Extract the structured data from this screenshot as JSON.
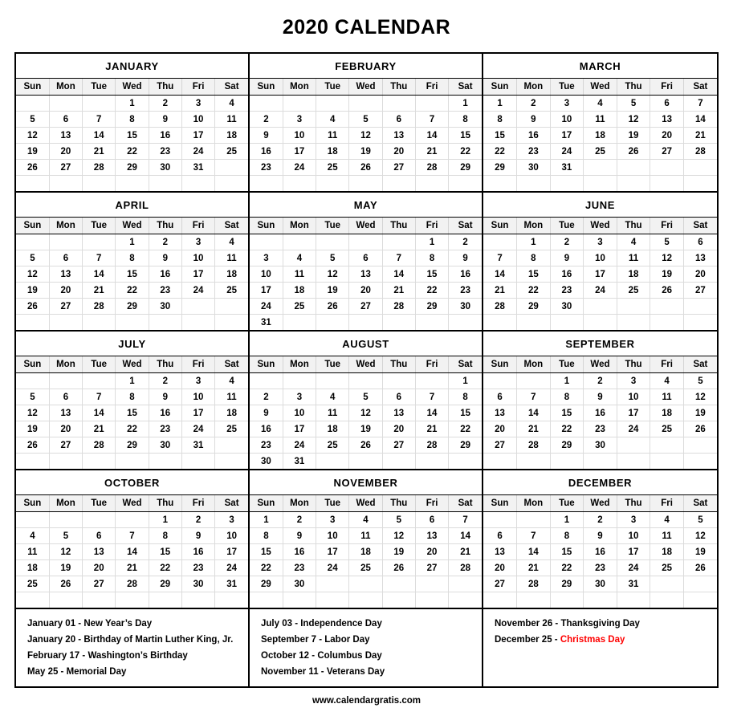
{
  "page": {
    "title": "2020 CALENDAR",
    "footer_url": "www.calendargratis.com",
    "year": 2020,
    "accent_red": "#ff0000",
    "header_bg": "#f2f2f2",
    "highlight_bg": "#ededed"
  },
  "weekdays": [
    "Sun",
    "Mon",
    "Tue",
    "Wed",
    "Thu",
    "Fri",
    "Sat"
  ],
  "months": [
    {
      "name": "JANUARY",
      "weeks": [
        [
          "",
          "",
          "",
          "1",
          "2",
          "3",
          "4"
        ],
        [
          "5",
          "6",
          "7",
          "8",
          "9",
          "10",
          "11"
        ],
        [
          "12",
          "13",
          "14",
          "15",
          "16",
          "17",
          "18"
        ],
        [
          "19",
          "20",
          "21",
          "22",
          "23",
          "24",
          "25"
        ],
        [
          "26",
          "27",
          "28",
          "29",
          "30",
          "31",
          ""
        ],
        [
          "",
          "",
          "",
          "",
          "",
          "",
          ""
        ]
      ],
      "highlight": []
    },
    {
      "name": "FEBRUARY",
      "weeks": [
        [
          "",
          "",
          "",
          "",
          "",
          "",
          "1"
        ],
        [
          "2",
          "3",
          "4",
          "5",
          "6",
          "7",
          "8"
        ],
        [
          "9",
          "10",
          "11",
          "12",
          "13",
          "14",
          "15"
        ],
        [
          "16",
          "17",
          "18",
          "19",
          "20",
          "21",
          "22"
        ],
        [
          "23",
          "24",
          "25",
          "26",
          "27",
          "28",
          "29"
        ],
        [
          "",
          "",
          "",
          "",
          "",
          "",
          ""
        ]
      ],
      "highlight": [
        [
          4,
          6
        ]
      ]
    },
    {
      "name": "MARCH",
      "weeks": [
        [
          "1",
          "2",
          "3",
          "4",
          "5",
          "6",
          "7"
        ],
        [
          "8",
          "9",
          "10",
          "11",
          "12",
          "13",
          "14"
        ],
        [
          "15",
          "16",
          "17",
          "18",
          "19",
          "20",
          "21"
        ],
        [
          "22",
          "23",
          "24",
          "25",
          "26",
          "27",
          "28"
        ],
        [
          "29",
          "30",
          "31",
          "",
          "",
          "",
          ""
        ],
        [
          "",
          "",
          "",
          "",
          "",
          "",
          ""
        ]
      ],
      "highlight": []
    },
    {
      "name": "APRIL",
      "weeks": [
        [
          "",
          "",
          "",
          "1",
          "2",
          "3",
          "4"
        ],
        [
          "5",
          "6",
          "7",
          "8",
          "9",
          "10",
          "11"
        ],
        [
          "12",
          "13",
          "14",
          "15",
          "16",
          "17",
          "18"
        ],
        [
          "19",
          "20",
          "21",
          "22",
          "23",
          "24",
          "25"
        ],
        [
          "26",
          "27",
          "28",
          "29",
          "30",
          "",
          ""
        ],
        [
          "",
          "",
          "",
          "",
          "",
          "",
          ""
        ]
      ],
      "highlight": []
    },
    {
      "name": "MAY",
      "weeks": [
        [
          "",
          "",
          "",
          "",
          "",
          "1",
          "2"
        ],
        [
          "3",
          "4",
          "5",
          "6",
          "7",
          "8",
          "9"
        ],
        [
          "10",
          "11",
          "12",
          "13",
          "14",
          "15",
          "16"
        ],
        [
          "17",
          "18",
          "19",
          "20",
          "21",
          "22",
          "23"
        ],
        [
          "24",
          "25",
          "26",
          "27",
          "28",
          "29",
          "30"
        ],
        [
          "31",
          "",
          "",
          "",
          "",
          "",
          ""
        ]
      ],
      "highlight": []
    },
    {
      "name": "JUNE",
      "weeks": [
        [
          "",
          "1",
          "2",
          "3",
          "4",
          "5",
          "6"
        ],
        [
          "7",
          "8",
          "9",
          "10",
          "11",
          "12",
          "13"
        ],
        [
          "14",
          "15",
          "16",
          "17",
          "18",
          "19",
          "20"
        ],
        [
          "21",
          "22",
          "23",
          "24",
          "25",
          "26",
          "27"
        ],
        [
          "28",
          "29",
          "30",
          "",
          "",
          "",
          ""
        ],
        [
          "",
          "",
          "",
          "",
          "",
          "",
          ""
        ]
      ],
      "highlight": []
    },
    {
      "name": "JULY",
      "weeks": [
        [
          "",
          "",
          "",
          "1",
          "2",
          "3",
          "4"
        ],
        [
          "5",
          "6",
          "7",
          "8",
          "9",
          "10",
          "11"
        ],
        [
          "12",
          "13",
          "14",
          "15",
          "16",
          "17",
          "18"
        ],
        [
          "19",
          "20",
          "21",
          "22",
          "23",
          "24",
          "25"
        ],
        [
          "26",
          "27",
          "28",
          "29",
          "30",
          "31",
          ""
        ],
        [
          "",
          "",
          "",
          "",
          "",
          "",
          ""
        ]
      ],
      "highlight": []
    },
    {
      "name": "AUGUST",
      "weeks": [
        [
          "",
          "",
          "",
          "",
          "",
          "",
          "1"
        ],
        [
          "2",
          "3",
          "4",
          "5",
          "6",
          "7",
          "8"
        ],
        [
          "9",
          "10",
          "11",
          "12",
          "13",
          "14",
          "15"
        ],
        [
          "16",
          "17",
          "18",
          "19",
          "20",
          "21",
          "22"
        ],
        [
          "23",
          "24",
          "25",
          "26",
          "27",
          "28",
          "29"
        ],
        [
          "30",
          "31",
          "",
          "",
          "",
          "",
          ""
        ]
      ],
      "highlight": []
    },
    {
      "name": "SEPTEMBER",
      "weeks": [
        [
          "",
          "",
          "1",
          "2",
          "3",
          "4",
          "5"
        ],
        [
          "6",
          "7",
          "8",
          "9",
          "10",
          "11",
          "12"
        ],
        [
          "13",
          "14",
          "15",
          "16",
          "17",
          "18",
          "19"
        ],
        [
          "20",
          "21",
          "22",
          "23",
          "24",
          "25",
          "26"
        ],
        [
          "27",
          "28",
          "29",
          "30",
          "",
          "",
          ""
        ],
        [
          "",
          "",
          "",
          "",
          "",
          "",
          ""
        ]
      ],
      "highlight": []
    },
    {
      "name": "OCTOBER",
      "weeks": [
        [
          "",
          "",
          "",
          "",
          "1",
          "2",
          "3"
        ],
        [
          "4",
          "5",
          "6",
          "7",
          "8",
          "9",
          "10"
        ],
        [
          "11",
          "12",
          "13",
          "14",
          "15",
          "16",
          "17"
        ],
        [
          "18",
          "19",
          "20",
          "21",
          "22",
          "23",
          "24"
        ],
        [
          "25",
          "26",
          "27",
          "28",
          "29",
          "30",
          "31"
        ],
        [
          "",
          "",
          "",
          "",
          "",
          "",
          ""
        ]
      ],
      "highlight": []
    },
    {
      "name": "NOVEMBER",
      "weeks": [
        [
          "1",
          "2",
          "3",
          "4",
          "5",
          "6",
          "7"
        ],
        [
          "8",
          "9",
          "10",
          "11",
          "12",
          "13",
          "14"
        ],
        [
          "15",
          "16",
          "17",
          "18",
          "19",
          "20",
          "21"
        ],
        [
          "22",
          "23",
          "24",
          "25",
          "26",
          "27",
          "28"
        ],
        [
          "29",
          "30",
          "",
          "",
          "",
          "",
          ""
        ],
        [
          "",
          "",
          "",
          "",
          "",
          "",
          ""
        ]
      ],
      "highlight": []
    },
    {
      "name": "DECEMBER",
      "weeks": [
        [
          "",
          "",
          "1",
          "2",
          "3",
          "4",
          "5"
        ],
        [
          "6",
          "7",
          "8",
          "9",
          "10",
          "11",
          "12"
        ],
        [
          "13",
          "14",
          "15",
          "16",
          "17",
          "18",
          "19"
        ],
        [
          "20",
          "21",
          "22",
          "23",
          "24",
          "25",
          "26"
        ],
        [
          "27",
          "28",
          "29",
          "30",
          "31",
          "",
          ""
        ],
        [
          "",
          "",
          "",
          "",
          "",
          "",
          ""
        ]
      ],
      "highlight": []
    }
  ],
  "holiday_columns": [
    {
      "items": [
        {
          "date": "January 01",
          "sep": " - ",
          "name": "New Year’s Day",
          "red": false
        },
        {
          "date": "January 20",
          "sep": " - ",
          "name": "Birthday of Martin Luther King, Jr.",
          "red": false
        },
        {
          "date": "February 17",
          "sep": " - ",
          "name": "Washington’s Birthday",
          "red": false
        },
        {
          "date": "May 25",
          "sep": " - ",
          "name": "Memorial Day",
          "red": false
        }
      ]
    },
    {
      "items": [
        {
          "date": "July 03",
          "sep": " - ",
          "name": "Independence Day",
          "red": false
        },
        {
          "date": "September 7",
          "sep": " - ",
          "name": "Labor Day",
          "red": false
        },
        {
          "date": "October 12",
          "sep": " - ",
          "name": "Columbus Day",
          "red": false
        },
        {
          "date": "November 11",
          "sep": " - ",
          "name": "Veterans Day",
          "red": false
        }
      ]
    },
    {
      "items": [
        {
          "date": "November 26",
          "sep": " - ",
          "name": "Thanksgiving Day",
          "red": false
        },
        {
          "date": "December 25",
          "sep": " - ",
          "name": "Christmas Day",
          "red": true
        }
      ]
    }
  ]
}
